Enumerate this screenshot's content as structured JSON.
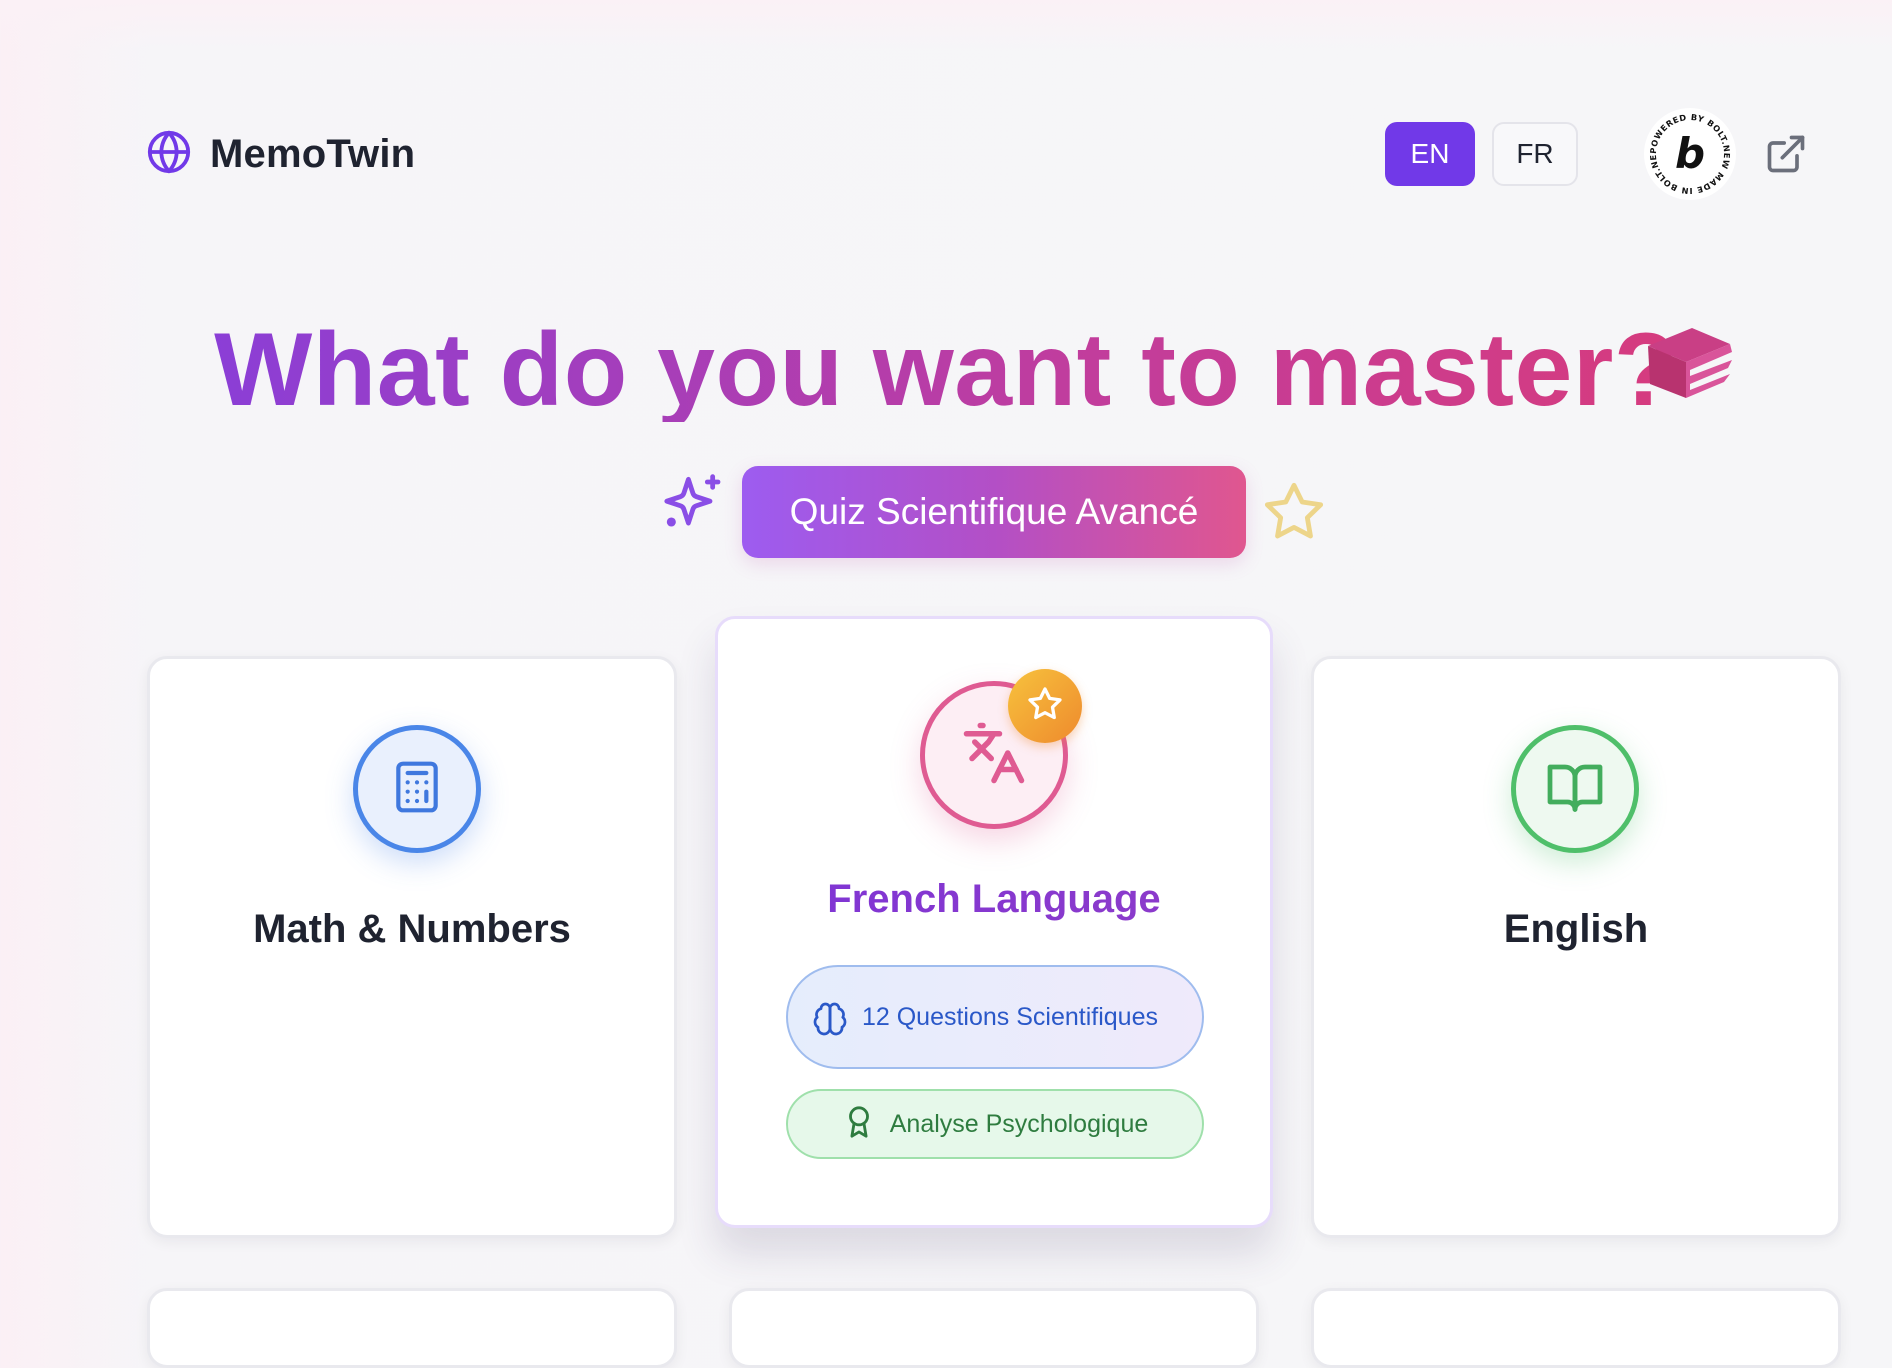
{
  "header": {
    "brand_name": "MemoTwin",
    "brand_icon": "globe-icon",
    "lang_en_label": "EN",
    "lang_fr_label": "FR",
    "active_language": "EN",
    "bolt_badge_text": "POWERED BY BOLT.NEW MADE IN BOLT.NEW",
    "external_link_icon": "external-link-icon"
  },
  "hero": {
    "title": "What do you want to master?",
    "title_icon": "books-icon",
    "quiz_pill_label": "Quiz Scientifique Avancé",
    "left_icon": "sparkles-icon",
    "right_icon": "star-outline-icon"
  },
  "cards": {
    "math": {
      "title": "Math & Numbers",
      "icon": "calculator-icon",
      "color": "#4a86e8"
    },
    "french": {
      "title": "French Language",
      "icon": "languages-icon",
      "color": "#df5b92",
      "featured_icon": "star-icon",
      "tag_questions": "12 Questions Scientifiques",
      "tag_questions_icon": "brain-icon",
      "tag_analysis": "Analyse Psychologique",
      "tag_analysis_icon": "award-icon"
    },
    "english": {
      "title": "English",
      "icon": "book-open-icon",
      "color": "#4fbf6a"
    }
  },
  "colors": {
    "accent": "#7139e8",
    "title_gradient_start": "#8b3ed6",
    "title_gradient_end": "#d63b7e"
  }
}
